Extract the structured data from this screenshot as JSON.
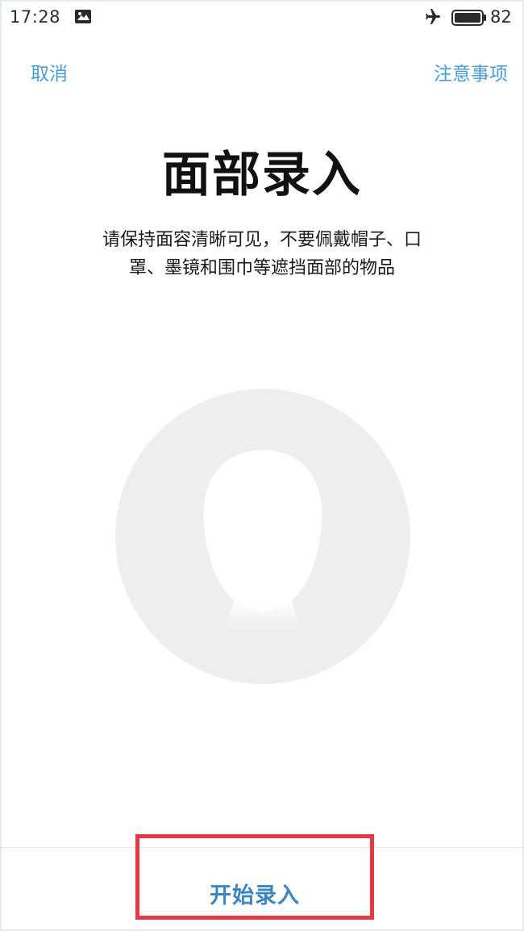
{
  "status_bar": {
    "time": "17:28",
    "notification_icon": "image-notification-icon",
    "airplane_icon": "airplane-mode-icon",
    "battery_icon": "battery-icon",
    "battery_level": "82"
  },
  "nav": {
    "cancel_label": "取消",
    "notes_label": "注意事项"
  },
  "main": {
    "title": "面部录入",
    "description_line1": "请保持面容清晰可见，不要佩戴帽子、口",
    "description_line2": "罩、墨镜和围巾等遮挡面部的物品"
  },
  "footer": {
    "start_label": "开始录入",
    "highlight_color": "#e53946"
  },
  "colors": {
    "accent": "#4a9ad6",
    "face_circle": "#eeeeee"
  }
}
